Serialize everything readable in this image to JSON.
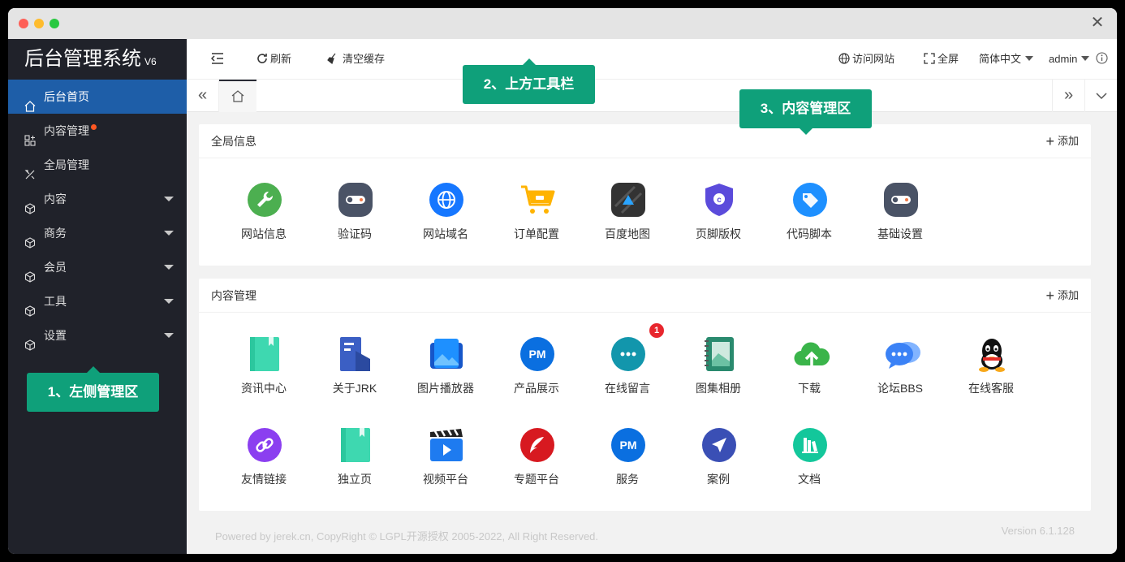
{
  "window": {
    "close_glyph": "✕"
  },
  "sidebar": {
    "logo": "后台管理系统",
    "logo_version": "V6",
    "items": [
      {
        "label": "后台首页",
        "icon": "home-icon",
        "active": true
      },
      {
        "label": "内容管理",
        "icon": "apps-icon",
        "dot": true
      },
      {
        "label": "全局管理",
        "icon": "tools-icon"
      },
      {
        "label": "内容",
        "icon": "cube-icon",
        "caret": true
      },
      {
        "label": "商务",
        "icon": "cube-icon",
        "caret": true
      },
      {
        "label": "会员",
        "icon": "cube-icon",
        "caret": true
      },
      {
        "label": "工具",
        "icon": "cube-icon",
        "caret": true
      },
      {
        "label": "设置",
        "icon": "cube-icon",
        "caret": true
      }
    ]
  },
  "callouts": {
    "left": "1、左侧管理区",
    "top": "2、上方工具栏",
    "content": "3、内容管理区"
  },
  "header": {
    "refresh": "刷新",
    "clear_cache": "清空缓存",
    "visit_site": "访问网站",
    "fullscreen": "全屏",
    "language": "简体中文",
    "user": "admin"
  },
  "tabbar": {
    "left_glyph": "«",
    "right_glyph": "»"
  },
  "global_card": {
    "title": "全局信息",
    "add": "添加",
    "items": [
      {
        "label": "网站信息",
        "icon": "wrench-icon",
        "color": "#4caf50"
      },
      {
        "label": "验证码",
        "icon": "toggle-icon",
        "color": "#4a5366"
      },
      {
        "label": "网站域名",
        "icon": "globe-icon",
        "color": "#1677ff"
      },
      {
        "label": "订单配置",
        "icon": "cart-icon",
        "color": "#ffb300"
      },
      {
        "label": "百度地图",
        "icon": "map-icon",
        "color": "#333333"
      },
      {
        "label": "页脚版权",
        "icon": "shield-icon",
        "color": "#5b4bdb"
      },
      {
        "label": "代码脚本",
        "icon": "tag-icon",
        "color": "#1e90ff"
      },
      {
        "label": "基础设置",
        "icon": "toggle-icon",
        "color": "#4a5366"
      }
    ]
  },
  "content_card": {
    "title": "内容管理",
    "add": "添加",
    "items": [
      {
        "label": "资讯中心",
        "icon": "book-icon",
        "color": "#3ed8b0"
      },
      {
        "label": "关于JRK",
        "icon": "document-icon",
        "color": "#2b4aa0"
      },
      {
        "label": "图片播放器",
        "icon": "gallery-icon",
        "color": "#1e90ff"
      },
      {
        "label": "产品展示",
        "icon": "pm-icon",
        "color": "#0a6fe0"
      },
      {
        "label": "在线留言",
        "icon": "chat-icon",
        "color": "#1296ac",
        "badge": "1"
      },
      {
        "label": "图集相册",
        "icon": "album-icon",
        "color": "#2a8a6e"
      },
      {
        "label": "下载",
        "icon": "cloud-upload-icon",
        "color": "#3ab44a"
      },
      {
        "label": "论坛BBS",
        "icon": "forum-icon",
        "color": "#3b82f6"
      },
      {
        "label": "在线客服",
        "icon": "qq-icon",
        "color": "#111111"
      },
      {
        "label": "友情链接",
        "icon": "link-icon",
        "color": "#8b3ff0"
      },
      {
        "label": "独立页",
        "icon": "book-icon",
        "color": "#3ed8b0"
      },
      {
        "label": "视频平台",
        "icon": "video-icon",
        "color": "#1e7bf0"
      },
      {
        "label": "专题平台",
        "icon": "feather-icon",
        "color": "#d71920"
      },
      {
        "label": "服务",
        "icon": "pm-icon",
        "color": "#0a6fe0"
      },
      {
        "label": "案例",
        "icon": "send-icon",
        "color": "#3a4fb5"
      },
      {
        "label": "文档",
        "icon": "books-icon",
        "color": "#13c79b"
      }
    ]
  },
  "footer": {
    "text": "Powered by jerek.cn, CopyRight © LGPL开源授权 2005-2022, All Right Reserved.",
    "version": "Version 6.1.128"
  }
}
